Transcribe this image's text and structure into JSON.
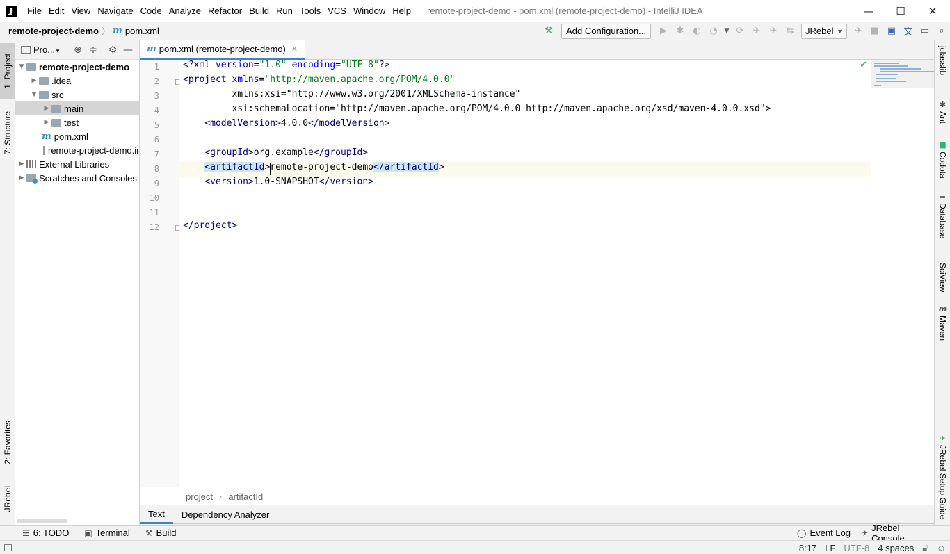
{
  "window": {
    "title": "remote-project-demo - pom.xml (remote-project-demo) - IntelliJ IDEA",
    "app_icon": "intellij-logo",
    "controls": {
      "minimize": "—",
      "maximize": "☐",
      "close": "✕"
    }
  },
  "menu": [
    "File",
    "Edit",
    "View",
    "Navigate",
    "Code",
    "Analyze",
    "Refactor",
    "Build",
    "Run",
    "Tools",
    "VCS",
    "Window",
    "Help"
  ],
  "navbar": {
    "project": "remote-project-demo",
    "file": "pom.xml",
    "add_configuration": "Add Configuration...",
    "jrebel_select": "JRebel"
  },
  "left_strip": {
    "project": "1: Project",
    "structure": "7: Structure",
    "favorites": "2: Favorites",
    "jrebel": "JRebel"
  },
  "project_panel": {
    "title": "Pro...",
    "tree": [
      {
        "label": "remote-project-demo",
        "bold": true,
        "expanded": true
      },
      {
        "label": ".idea"
      },
      {
        "label": "src"
      },
      {
        "label": "main",
        "selected": true
      },
      {
        "label": "test"
      },
      {
        "label": "pom.xml"
      },
      {
        "label": "remote-project-demo.iml"
      },
      {
        "label": "External Libraries"
      },
      {
        "label": "Scratches and Consoles"
      }
    ]
  },
  "editor": {
    "tab_label": "pom.xml (remote-project-demo)",
    "current_line": 8,
    "caret": {
      "line": 8,
      "column": 17
    },
    "lines": [
      "<?xml version=\"1.0\" encoding=\"UTF-8\"?>",
      "<project xmlns=\"http://maven.apache.org/POM/4.0.0\"",
      "         xmlns:xsi=\"http://www.w3.org/2001/XMLSchema-instance\"",
      "         xsi:schemaLocation=\"http://maven.apache.org/POM/4.0.0 http://maven.apache.org/xsd/maven-4.0.0.xsd\">",
      "    <modelVersion>4.0.0</modelVersion>",
      "",
      "    <groupId>org.example</groupId>",
      "    <artifactId>remote-project-demo</artifactId>",
      "    <version>1.0-SNAPSHOT</version>",
      "",
      "",
      "</project>"
    ],
    "breadcrumb": [
      "project",
      "artifactId"
    ],
    "bottom_tabs": [
      "Text",
      "Dependency Analyzer"
    ],
    "active_bottom_tab": "Text"
  },
  "right_strip": [
    "jclasslib",
    "Ant",
    "Codota",
    "Database",
    "SciView",
    "Maven",
    "JRebel Setup Guide"
  ],
  "toolwindows": {
    "todo": "6: TODO",
    "terminal": "Terminal",
    "build": "Build",
    "event_log": "Event Log",
    "jrebel_console": "JRebel Console"
  },
  "status": {
    "position": "8:17",
    "line_sep": "LF",
    "encoding": "UTF-8",
    "indent": "4 spaces"
  },
  "colors": {
    "accent": "#4083c9",
    "xml_tag": "#000080",
    "xml_attr": "#0000ff",
    "xml_namespace": "#660e7a",
    "xml_value": "#067d17"
  }
}
